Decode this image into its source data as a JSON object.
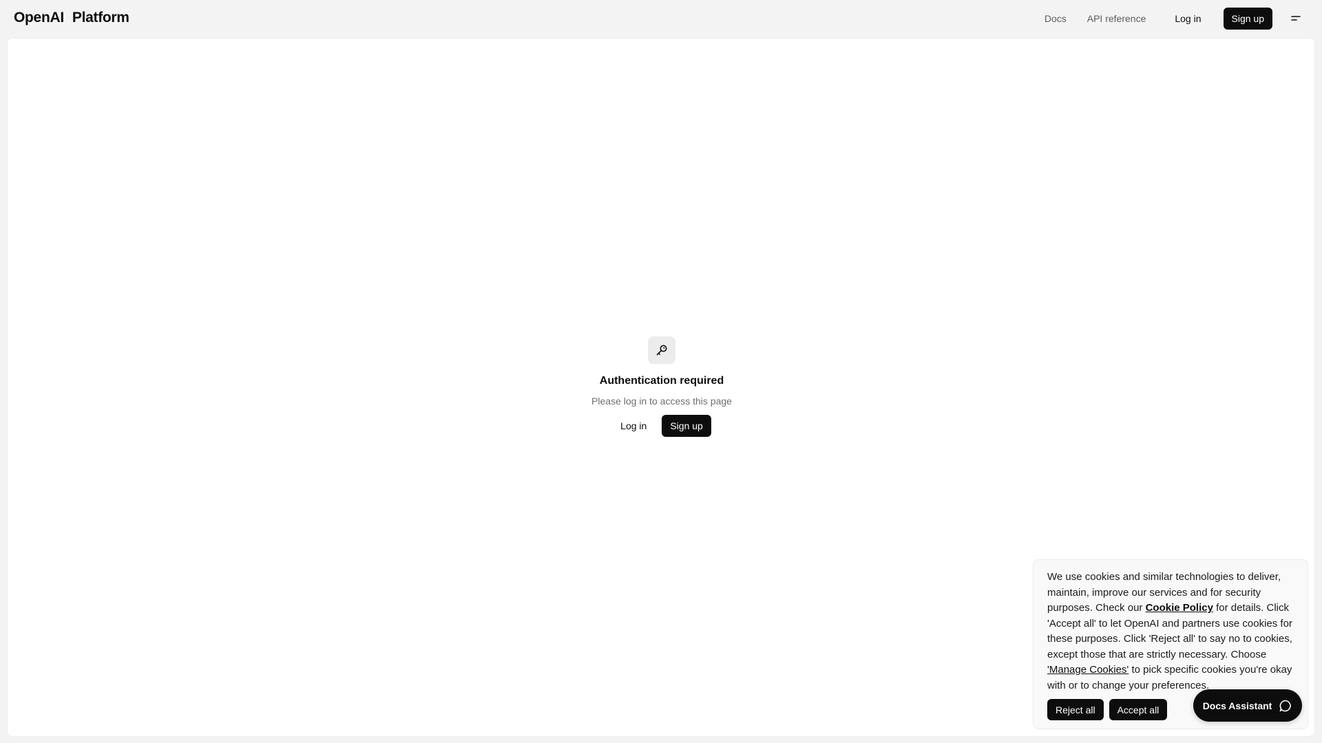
{
  "header": {
    "brand_primary": "OpenAI",
    "brand_secondary": "Platform",
    "nav": {
      "docs": "Docs",
      "api_reference": "API reference",
      "login": "Log in",
      "signup": "Sign up"
    },
    "menu_icon": "menu-icon"
  },
  "auth": {
    "icon": "key-icon",
    "title": "Authentication required",
    "subtitle": "Please log in to access this page",
    "login": "Log in",
    "signup": "Sign up"
  },
  "cookie_banner": {
    "text_1": "We use cookies and similar technologies to deliver, maintain, improve our services and for security purposes. Check our ",
    "policy_link": "Cookie Policy",
    "text_2": " for details. Click 'Accept all' to let OpenAI and partners use cookies for these purposes. Click 'Reject all' to say no to cookies, except those that are strictly necessary. Choose ",
    "manage_link": "'Manage Cookies'",
    "text_3": " to pick specific cookies you're okay with or to change your preferences.",
    "reject_all": "Reject all",
    "accept_all": "Accept all"
  },
  "assistant": {
    "label": "Docs Assistant",
    "icon": "chat-bubble-icon"
  },
  "colors": {
    "page_bg": "#f3f3f3",
    "surface": "#ffffff",
    "primary": "#0d0d0d",
    "muted_text": "#6e6e6e"
  }
}
